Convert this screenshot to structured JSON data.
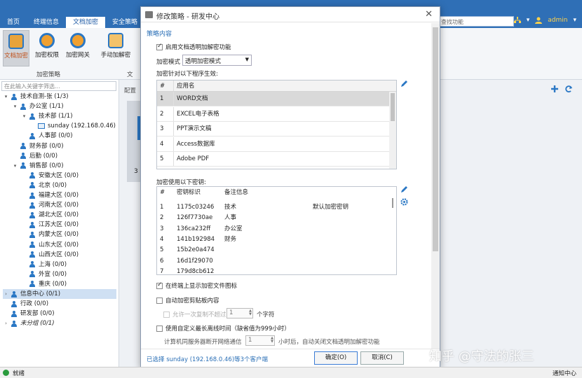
{
  "top_tabs": [
    "首页",
    "终端信息",
    "文档加密",
    "安全策略"
  ],
  "active_tab": "文档加密",
  "global_search": "查找功能",
  "user": "admin",
  "ribbon": {
    "buttons": [
      "文档加密",
      "加密权限",
      "加密网关",
      "手动加解密"
    ],
    "group_label": "加密策略",
    "group_label2": "文"
  },
  "tree": {
    "search_placeholder": "在此输入关键字筛选...",
    "rows": [
      {
        "label": "技术自测-张 (1/3)",
        "level": 0,
        "tw": "▾",
        "icon": "people"
      },
      {
        "label": "办公室 (1/1)",
        "level": 1,
        "tw": "▾",
        "icon": "people"
      },
      {
        "label": "技术部 (1/1)",
        "level": 2,
        "tw": "▾",
        "icon": "people"
      },
      {
        "label": "sunday (192.168.0.46)",
        "level": 3,
        "tw": "",
        "icon": "pc"
      },
      {
        "label": "人事部 (0/0)",
        "level": 2,
        "tw": "",
        "icon": "people"
      },
      {
        "label": "财务部 (0/0)",
        "level": 1,
        "tw": "",
        "icon": "people"
      },
      {
        "label": "后勤 (0/0)",
        "level": 1,
        "tw": "",
        "icon": "people"
      },
      {
        "label": "销售部 (0/0)",
        "level": 1,
        "tw": "▾",
        "icon": "people"
      },
      {
        "label": "安徽大区 (0/0)",
        "level": 2,
        "tw": "",
        "icon": "people"
      },
      {
        "label": "北京 (0/0)",
        "level": 2,
        "tw": "",
        "icon": "people"
      },
      {
        "label": "福建大区 (0/0)",
        "level": 2,
        "tw": "",
        "icon": "people"
      },
      {
        "label": "河南大区 (0/0)",
        "level": 2,
        "tw": "",
        "icon": "people"
      },
      {
        "label": "湖北大区 (0/0)",
        "level": 2,
        "tw": "",
        "icon": "people"
      },
      {
        "label": "江苏大区 (0/0)",
        "level": 2,
        "tw": "",
        "icon": "people"
      },
      {
        "label": "内蒙大区 (0/0)",
        "level": 2,
        "tw": "",
        "icon": "people"
      },
      {
        "label": "山东大区 (0/0)",
        "level": 2,
        "tw": "",
        "icon": "people"
      },
      {
        "label": "山西大区 (0/0)",
        "level": 2,
        "tw": "",
        "icon": "people"
      },
      {
        "label": "上海 (0/0)",
        "level": 2,
        "tw": "",
        "icon": "people"
      },
      {
        "label": "外宣 (0/0)",
        "level": 2,
        "tw": "",
        "icon": "people"
      },
      {
        "label": "重庆 (0/0)",
        "level": 2,
        "tw": "",
        "icon": "people"
      },
      {
        "label": "信息中心 (0/1)",
        "level": 0,
        "tw": "›",
        "icon": "people"
      },
      {
        "label": "行政 (0/0)",
        "level": 0,
        "tw": "",
        "icon": "people"
      },
      {
        "label": "研发部 (0/0)",
        "level": 0,
        "tw": "",
        "icon": "people"
      },
      {
        "label": "未分组 (0/1)",
        "level": 0,
        "tw": "›",
        "icon": "people"
      }
    ],
    "selected": "信息中心 (0/1)"
  },
  "right": {
    "cfg_label": "配置",
    "bg_number": "3"
  },
  "dialog": {
    "title": "修改策略 - 研发中心",
    "section": "策略内容",
    "enable_label": "启用文档透明加解密功能",
    "enable_checked": true,
    "mode_label": "加密模式",
    "mode_value": "透明加密模式",
    "apps_label": "加密针对以下程序生效:",
    "apps_headers": [
      "#",
      "应用名"
    ],
    "apps": [
      {
        "n": "1",
        "name": "WORD文档"
      },
      {
        "n": "2",
        "name": "EXCEL电子表格"
      },
      {
        "n": "3",
        "name": "PPT演示文稿"
      },
      {
        "n": "4",
        "name": "Access数据库"
      },
      {
        "n": "5",
        "name": "Adobe PDF"
      }
    ],
    "keys_label": "加密使用以下密钥:",
    "keys_headers": [
      "#",
      "密钥标识",
      "备注信息"
    ],
    "keys": [
      {
        "n": "1",
        "id": "1175c03246",
        "note": "技术",
        "extra": "默认加密密钥"
      },
      {
        "n": "2",
        "id": "126f7730ae",
        "note": "人事",
        "extra": ""
      },
      {
        "n": "3",
        "id": "136ca232ff",
        "note": "办公室",
        "extra": ""
      },
      {
        "n": "4",
        "id": "141b192984",
        "note": "财务",
        "extra": ""
      },
      {
        "n": "5",
        "id": "15b2e0a474",
        "note": "",
        "extra": ""
      },
      {
        "n": "6",
        "id": "16d1f29070",
        "note": "",
        "extra": ""
      },
      {
        "n": "7",
        "id": "179d8cb612",
        "note": "",
        "extra": ""
      }
    ],
    "opt_show_icon": "在终端上显示加密文件图标",
    "opt_clipboard": "自动加密剪贴板内容",
    "opt_copy_limit": "允许一次复制不超过",
    "copy_limit_value": "1",
    "copy_limit_unit": "个字符",
    "opt_offline": "使用自定义最长离线时间（缺省值为999小时）",
    "offline_prefix": "计算机同服务器断开网络通信",
    "offline_value": "1",
    "offline_suffix": "小时后，自动关闭文档透明加解密功能",
    "selected_info": "已选择 sunday (192.168.0.46)等3个客户端",
    "ok": "确定(O)",
    "cancel": "取消(C)"
  },
  "status": {
    "text": "就绪",
    "notify": "通知中心"
  },
  "watermark": "知乎 @守法的张三"
}
